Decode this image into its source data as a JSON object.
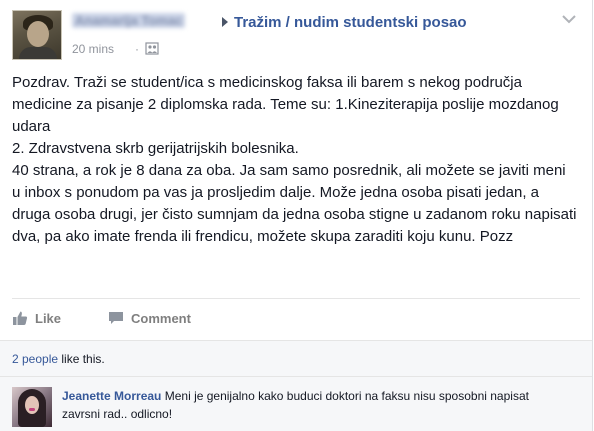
{
  "post": {
    "author_name": "Anamarija Tomac",
    "group_name": "Tražim / nudim studentski posao",
    "timestamp": "20 mins",
    "separator": "·",
    "audience_icon": "group-audience-icon",
    "options_icon": "chevron-down-icon",
    "body": "Pozdrav. Traži se student/ica s medicinskog faksa ili barem s nekog područja medicine za pisanje 2 diplomska rada. Teme su: 1.Kineziterapija poslije mozdanog udara\n2. Zdravstvena skrb gerijatrijskih bolesnika.\n40 strana, a rok je 8 dana za oba. Ja sam samo posrednik, ali možete se javiti meni u inbox s ponudom pa vas ja prosljedim dalje. Može jedna osoba pisati jedan, a druga osoba drugi, jer čisto sumnjam da jedna osoba stigne u zadanom roku napisati dva, pa ako imate frenda ili frendicu, možete skupa zaraditi koju kunu. Pozz"
  },
  "actions": {
    "like_label": "Like",
    "like_icon": "thumbs-up-icon",
    "comment_label": "Comment",
    "comment_icon": "speech-bubble-icon"
  },
  "likes": {
    "count_link": "2 people",
    "suffix": " like this."
  },
  "comments": [
    {
      "author": "Jeanette Morreau",
      "text": "Meni je genijalno kako buduci doktori na faksu nisu sposobni napisat zavrsni rad.. odlicno!"
    }
  ],
  "colors": {
    "link": "#365899",
    "muted": "#90949c",
    "panel": "#f6f7f9"
  }
}
